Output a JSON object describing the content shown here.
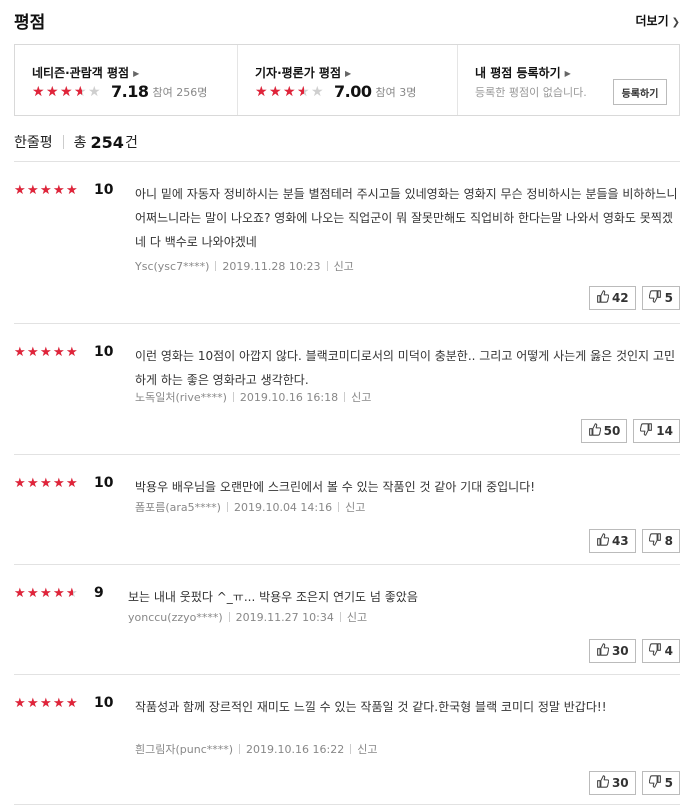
{
  "header": {
    "title": "평점",
    "more_label": "더보기"
  },
  "summary": {
    "audience": {
      "label": "네티즌·관람객 평점",
      "score": "7.18",
      "participants": "참여 256명",
      "rating": 0.718
    },
    "critics": {
      "label": "기자·평론가 평점",
      "score": "7.00",
      "participants": "참여 3명",
      "rating": 0.7
    },
    "mine": {
      "label": "내 평점 등록하기",
      "note": "등록한 평점이 없습니다.",
      "button": "등록하기"
    }
  },
  "count": {
    "label": "한줄평",
    "prefix": "총",
    "number": "254",
    "suffix": "건"
  },
  "reviews": [
    {
      "score": "10",
      "rating": 1.0,
      "text": "아니 밑에 자동자 정비하시는 분들 별점테러 주시고들 있네영화는 영화지 무슨 정비하시는 분들을 비하하느니 어쩌느니라는 말이 나오죠? 영화에 나오는 직업군이 뭐 잘못만해도 직업비하 한다는말 나와서 영화도 못찍겠네 다 백수로 나와야겠네",
      "user": "Ysc(ysc7****)",
      "date": "2019.11.28 10:23",
      "report": "신고",
      "likes": "42",
      "dislikes": "5"
    },
    {
      "score": "10",
      "rating": 1.0,
      "text": "이런 영화는 10점이 아깝지 않다. 블랙코미디로서의 미덕이 충분한.. 그리고 어떻게 사는게 옳은 것인지 고민하게 하는 좋은 영화라고 생각한다.",
      "user": "노독일처(rive****)",
      "date": "2019.10.16 16:18",
      "report": "신고",
      "likes": "50",
      "dislikes": "14"
    },
    {
      "score": "10",
      "rating": 1.0,
      "text": "박용우 배우님을 오랜만에 스크린에서 볼 수 있는 작품인 것 같아 기대 중입니다!",
      "user": "폼포름(ara5****)",
      "date": "2019.10.04 14:16",
      "report": "신고",
      "likes": "43",
      "dislikes": "8"
    },
    {
      "score": "9",
      "rating": 0.9,
      "text": "보는 내내 웃펐다 ^_ㅠ... 박용우 조은지 연기도 넘 좋았음",
      "user": "yonccu(zzyo****)",
      "date": "2019.11.27 10:34",
      "report": "신고",
      "likes": "30",
      "dislikes": "4"
    },
    {
      "score": "10",
      "rating": 1.0,
      "text": "작품성과 함께 장르적인 재미도 느낄 수 있는 작품일 것 같다.한국형 블랙 코미디 정말 반갑다!!",
      "user": "흰그림자(punc****)",
      "date": "2019.10.16 16:22",
      "report": "신고",
      "likes": "30",
      "dislikes": "5"
    }
  ],
  "colors": {
    "star_fill": "#e0243a",
    "star_empty": "#cfcfcf",
    "border": "#d9d9d9"
  },
  "icons": {
    "like": "thumbs-up-icon",
    "dislike": "thumbs-down-icon",
    "more": "chevron-right-icon"
  }
}
